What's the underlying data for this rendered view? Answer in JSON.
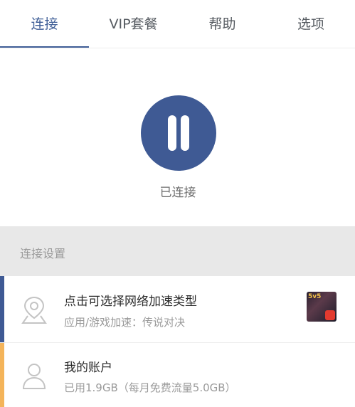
{
  "tabs": [
    {
      "label": "连接",
      "active": true
    },
    {
      "label": "VIP套餐",
      "active": false
    },
    {
      "label": "帮助",
      "active": false
    },
    {
      "label": "选项",
      "active": false
    }
  ],
  "connection": {
    "status": "已连接",
    "button_icon": "pause-icon"
  },
  "settings": {
    "section_title": "连接设置",
    "rows": [
      {
        "icon": "location-pin-icon",
        "title": "点击可选择网络加速类型",
        "subtitle": "应用/游戏加速：传说对决",
        "thumbnail_label": "5v5"
      },
      {
        "icon": "user-icon",
        "title": "我的账户",
        "subtitle": "已用1.9GB（每月免费流量5.0GB）"
      }
    ]
  },
  "colors": {
    "accent": "#3f5e97",
    "row_accent_1": "#3f5a94",
    "row_accent_2": "#f4b45a"
  }
}
